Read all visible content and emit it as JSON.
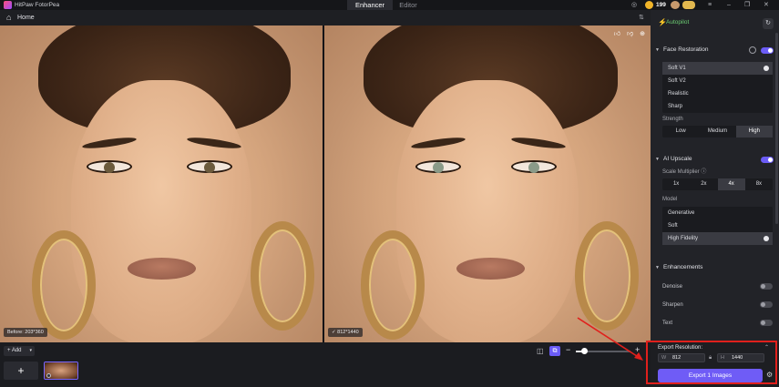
{
  "titlebar": {
    "app_name": "HitPaw FotorPea",
    "tabs": [
      {
        "label": "Enhancer",
        "active": true
      },
      {
        "label": "Editor",
        "active": false
      }
    ],
    "coins": "199",
    "icons": [
      "discord-icon",
      "cart-icon",
      "coin-icon",
      "user-avatar",
      "pro-badge",
      "menu-icon",
      "minimize-icon",
      "maximize-icon",
      "close-icon"
    ]
  },
  "homebar": {
    "label": "Home"
  },
  "images": {
    "before_label": "Before: 203*360",
    "after_label": "✓ 812*1440"
  },
  "panel": {
    "autopilot_label": "Autopilot",
    "face_restoration": {
      "title": "Face Restoration",
      "enabled": true,
      "options": [
        {
          "label": "Soft V1",
          "selected": true
        },
        {
          "label": "Soft V2",
          "selected": false
        },
        {
          "label": "Realistic",
          "selected": false
        },
        {
          "label": "Sharp",
          "selected": false
        }
      ],
      "strength_label": "Strength",
      "strength": [
        {
          "label": "Low",
          "selected": false
        },
        {
          "label": "Medium",
          "selected": false
        },
        {
          "label": "High",
          "selected": true
        }
      ]
    },
    "ai_upscale": {
      "title": "AI Upscale",
      "enabled": true,
      "scale_label": "Scale Multiplier",
      "scales": [
        {
          "label": "1x",
          "selected": false
        },
        {
          "label": "2x",
          "selected": false
        },
        {
          "label": "4x",
          "selected": true
        },
        {
          "label": "8x",
          "selected": false
        }
      ],
      "model_label": "Model",
      "models": [
        {
          "label": "Generative",
          "selected": false
        },
        {
          "label": "Soft",
          "selected": false
        },
        {
          "label": "High Fidelity",
          "selected": true
        }
      ]
    },
    "enhancements": {
      "title": "Enhancements",
      "items": [
        {
          "label": "Denoise",
          "enabled": false
        },
        {
          "label": "Sharpen",
          "enabled": false
        },
        {
          "label": "Text",
          "enabled": false
        }
      ]
    }
  },
  "export": {
    "title": "Export Resolution:",
    "width_letter": "W",
    "width": "812",
    "height_letter": "H",
    "height": "1440",
    "button": "Export 1 Images"
  },
  "bottom": {
    "add_label": "+ Add",
    "zoom_level": 0.15
  },
  "colors": {
    "accent": "#6b5cf6",
    "annotation": "#e0201c",
    "autopilot": "#6ccf73"
  }
}
